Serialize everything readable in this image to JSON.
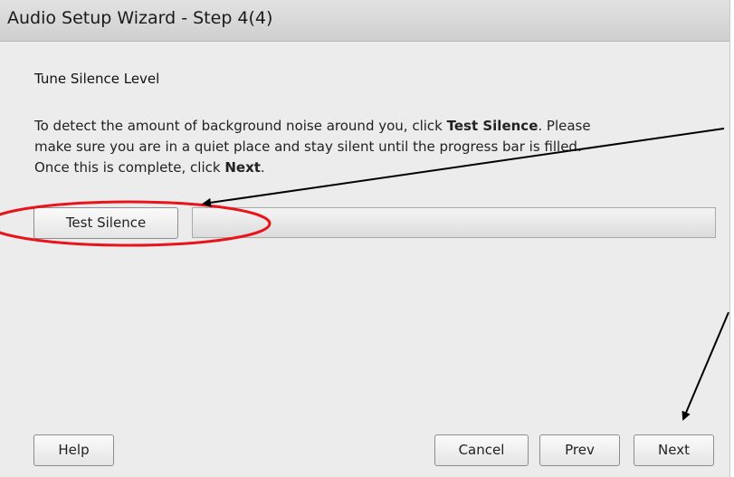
{
  "window": {
    "title": "Audio Setup Wizard - Step 4(4)"
  },
  "content": {
    "section_title": "Tune Silence Level",
    "description": {
      "line1_before": "To detect the amount of background noise around you, click ",
      "line1_bold": "Test Silence",
      "line1_after": ". Please",
      "line2": "make sure you are in a quiet place and stay silent until the progress bar is filled.",
      "line3_before": "Once this is complete, click ",
      "line3_bold": "Next",
      "line3_after": "."
    }
  },
  "test_silence": {
    "button_label": "Test Silence",
    "progress_fraction": 0
  },
  "footer": {
    "help_label": "Help",
    "cancel_label": "Cancel",
    "prev_label": "Prev",
    "next_label": "Next"
  },
  "annotations": {
    "highlight_color": "#e8141b",
    "arrow_color": "#000000"
  }
}
